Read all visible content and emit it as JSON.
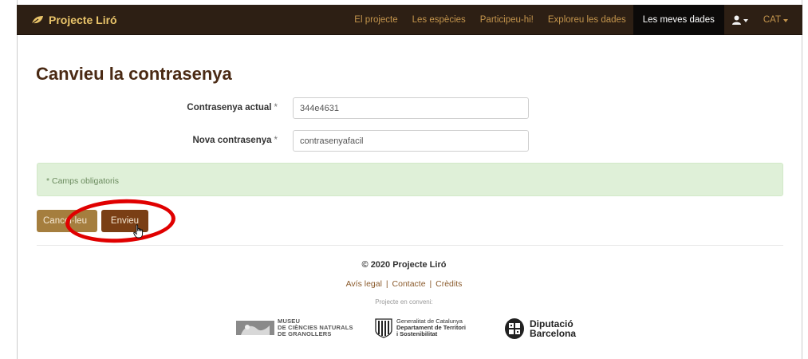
{
  "navbar": {
    "brand": "Projecte Liró",
    "items": [
      {
        "label": "El projecte"
      },
      {
        "label": "Les espècies"
      },
      {
        "label": "Participeu-hi!"
      },
      {
        "label": "Exploreu les dades"
      },
      {
        "label": "Les meves dades"
      }
    ],
    "lang": "CAT"
  },
  "page": {
    "title": "Canvieu la contrasenya"
  },
  "form": {
    "current_password": {
      "label": "Contrasenya actual",
      "required_mark": "*",
      "value": "344e4631"
    },
    "new_password": {
      "label": "Nova contrasenya",
      "required_mark": "*",
      "value": "contrasenyafacil"
    }
  },
  "alert": {
    "text": "* Camps obligatoris"
  },
  "buttons": {
    "cancel": "Cancel·leu",
    "send": "Envieu"
  },
  "footer": {
    "copyright": "© 2020 Projecte Liró",
    "links": [
      "Avís legal",
      "Contacte",
      "Crèdits"
    ],
    "link_separator": "|",
    "partnership": "Projecte en conveni:",
    "logos": {
      "museu": [
        "MUSEU",
        "DE CIÈNCIES NATURALS",
        "DE GRANOLLERS"
      ],
      "generalitat": [
        "Generalitat de Catalunya",
        "Departament de Territori",
        "i Sostenibilitat"
      ],
      "diputacio": [
        "Diputació",
        "Barcelona"
      ]
    }
  },
  "colors": {
    "navbar_bg": "#2d1f14",
    "brand": "#e9c46a",
    "title": "#4a2a14",
    "alert_bg": "#dff0d8",
    "btn_cancel": "#a57e3e",
    "btn_send": "#7a3f15",
    "highlight": "#e00000"
  },
  "icons": {
    "brand": "leaf-icon",
    "user": "user-icon",
    "cursor": "hand-pointer-icon"
  }
}
